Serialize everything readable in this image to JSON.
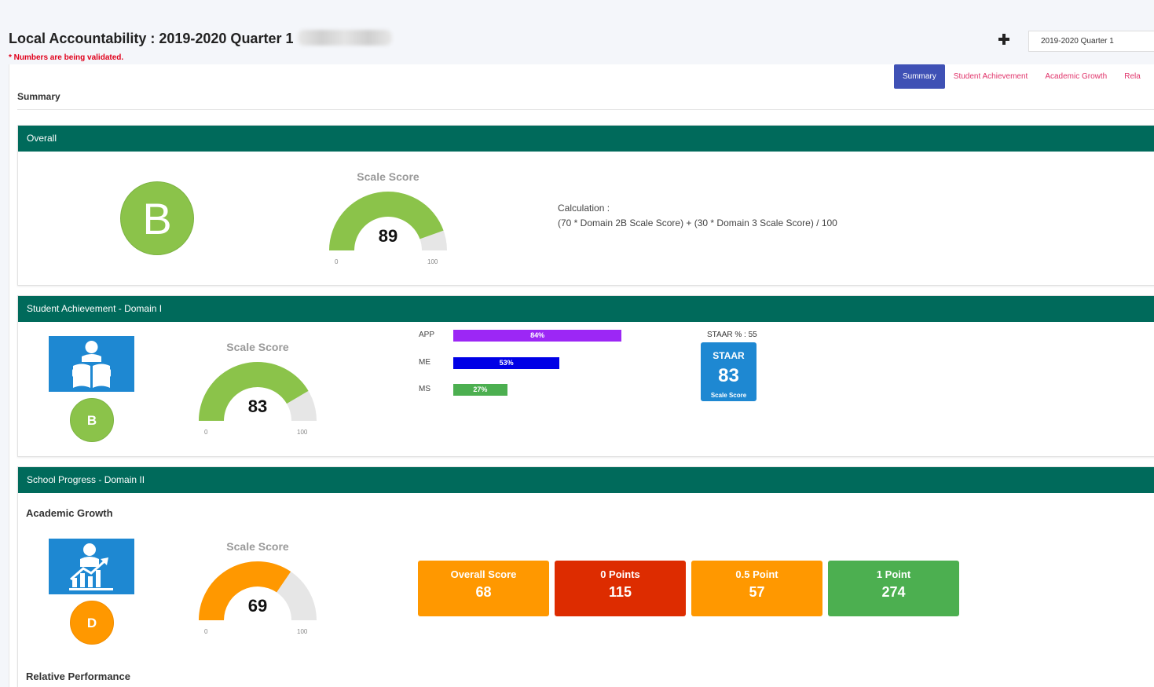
{
  "header": {
    "title": "Local Accountability : 2019-2020 Quarter 1",
    "validation_note": "* Numbers are being validated.",
    "quarter_select": "2019-2020 Quarter 1"
  },
  "tabs": [
    {
      "label": "Summary",
      "active": true
    },
    {
      "label": "Student Achievement",
      "active": false
    },
    {
      "label": "Academic Growth",
      "active": false
    },
    {
      "label": "Rela",
      "active": false
    }
  ],
  "summary_heading": "Summary",
  "overall": {
    "header": "Overall",
    "grade": "B",
    "gauge": {
      "title": "Scale Score",
      "value": 89,
      "min": "0",
      "max": "100",
      "color": "#8bc34a"
    },
    "calculation_label": "Calculation :",
    "calculation_formula": "(70 * Domain 2B Scale Score) + (30 * Domain 3 Scale Score) / 100"
  },
  "student_achievement": {
    "header": "Student Achievement - Domain I",
    "grade": "B",
    "icon": "reading-student-icon",
    "gauge": {
      "title": "Scale Score",
      "value": 83,
      "min": "0",
      "max": "100",
      "color": "#8bc34a"
    },
    "bars": [
      {
        "label": "APP",
        "value": 84,
        "text": "84%",
        "color": "#9c27f5"
      },
      {
        "label": "ME",
        "value": 53,
        "text": "53%",
        "color": "#0000e6"
      },
      {
        "label": "MS",
        "value": 27,
        "text": "27%",
        "color": "#4caf50"
      }
    ],
    "staar_pct": "STAAR % : 55",
    "staar": {
      "label": "STAAR",
      "value": "83",
      "sub": "Scale Score"
    }
  },
  "school_progress": {
    "header": "School Progress - Domain II",
    "academic_growth_heading": "Academic Growth",
    "grade": "D",
    "icon": "growth-chart-icon",
    "gauge": {
      "title": "Scale Score",
      "value": 69,
      "min": "0",
      "max": "100",
      "color": "#ff9800"
    },
    "score_boxes": [
      {
        "label": "Overall Score",
        "value": "68",
        "color": "#ff9800"
      },
      {
        "label": "0 Points",
        "value": "115",
        "color": "#dd2c00"
      },
      {
        "label": "0.5 Point",
        "value": "57",
        "color": "#ff9800"
      },
      {
        "label": "1 Point",
        "value": "274",
        "color": "#4caf50"
      }
    ],
    "relative_performance_heading": "Relative Performance"
  },
  "colors": {
    "section_header": "#006a5b",
    "tab_active": "#3f51b5",
    "tab_link": "#e0336a",
    "tile_blue": "#1e88d2"
  }
}
